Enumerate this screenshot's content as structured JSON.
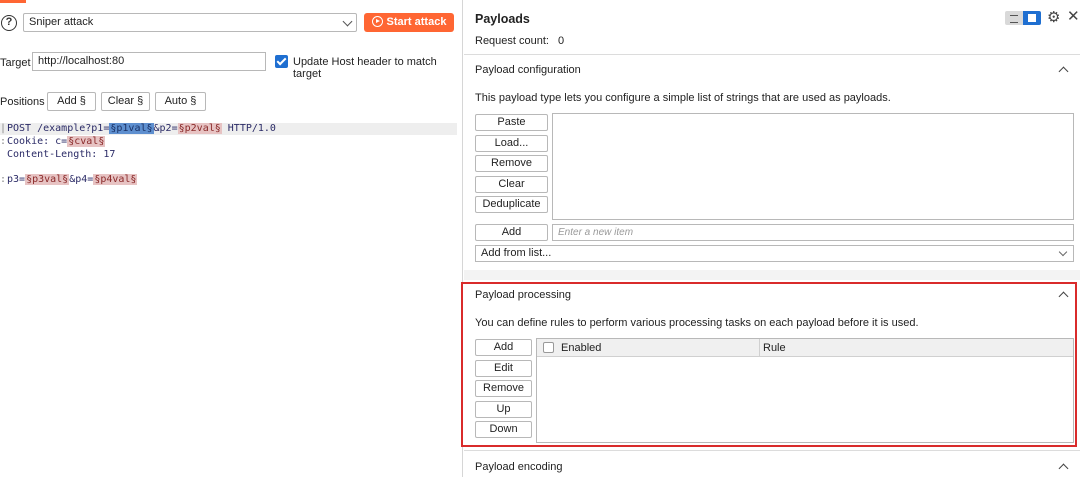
{
  "toolbar": {
    "help_icon": "?",
    "attack_type": "Sniper attack",
    "start_attack_label": "Start attack",
    "accent_color": "#ff6633"
  },
  "target": {
    "label": "Target",
    "value": "http://localhost:80",
    "update_host_label": "Update Host header to match target",
    "update_host_checked": true
  },
  "positions": {
    "label": "Positions",
    "add_label": "Add §",
    "clear_label": "Clear §",
    "auto_label": "Auto §"
  },
  "request": {
    "line1_pre": "POST /example?p1=",
    "p1": "§p1val§",
    "line1_mid": "&p2=",
    "p2": "§p2val§",
    "line1_post": " HTTP/1.0",
    "line2_pre": "Cookie: c=",
    "c": "§cval§",
    "line3": "Content-Length: 17",
    "line5_pre": "p3=",
    "p3": "§p3val§",
    "line5_mid": "&p4=",
    "p4": "§p4val§"
  },
  "payloads": {
    "title": "Payloads",
    "request_count_label": "Request count:",
    "request_count": "0",
    "gear_icon": "⚙",
    "close_icon": "✕"
  },
  "payload_configuration": {
    "title": "Payload configuration",
    "description": "This payload type lets you configure a simple list of strings that are used as payloads.",
    "buttons": [
      "Paste",
      "Load...",
      "Remove",
      "Clear",
      "Deduplicate"
    ],
    "add_label": "Add",
    "new_item_placeholder": "Enter a new item",
    "add_from_list": "Add from list..."
  },
  "payload_processing": {
    "title": "Payload processing",
    "description": "You can define rules to perform various processing tasks on each payload before it is used.",
    "buttons": [
      "Add",
      "Edit",
      "Remove",
      "Up",
      "Down"
    ],
    "columns": [
      "Enabled",
      "Rule"
    ],
    "highlight_color": "#d92b2b"
  },
  "payload_encoding": {
    "title": "Payload encoding"
  }
}
